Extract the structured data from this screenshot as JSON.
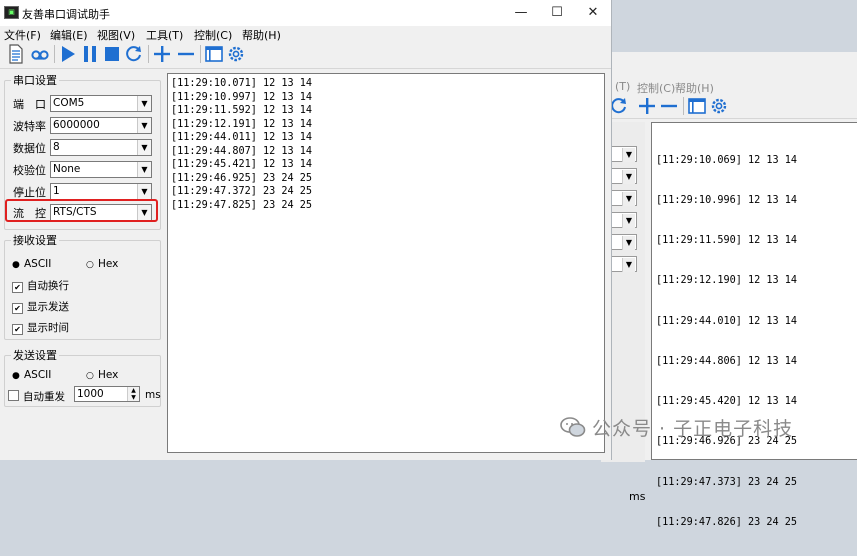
{
  "window": {
    "title": "友善串口调试助手",
    "controls": {
      "minimize": "—",
      "maximize": "☐",
      "close": "✕"
    }
  },
  "menu": [
    "文件(F)",
    "编辑(E)",
    "视图(V)",
    "工具(T)",
    "控制(C)",
    "帮助(H)"
  ],
  "bg_menu": [
    "(T)",
    "控制(C)",
    "帮助(H)"
  ],
  "serial_settings": {
    "legend": "串口设置",
    "fields": [
      {
        "label": "端　口",
        "value": "COM5"
      },
      {
        "label": "波特率",
        "value": "6000000"
      },
      {
        "label": "数据位",
        "value": "8"
      },
      {
        "label": "校验位",
        "value": "None"
      },
      {
        "label": "停止位",
        "value": "1"
      },
      {
        "label": "流　控",
        "value": "RTS/CTS"
      }
    ]
  },
  "receive_settings": {
    "legend": "接收设置",
    "radio_ascii": "ASCII",
    "radio_hex": "Hex",
    "checks": [
      "自动换行",
      "显示发送",
      "显示时间"
    ]
  },
  "send_settings": {
    "legend": "发送设置",
    "radio_ascii": "ASCII",
    "radio_hex": "Hex",
    "auto_resend": "自动重发",
    "interval": "1000",
    "unit": "ms"
  },
  "receive_lines": [
    "[11:29:10.071] 12 13 14",
    "[11:29:10.997] 12 13 14",
    "[11:29:11.592] 12 13 14",
    "[11:29:12.191] 12 13 14",
    "[11:29:44.011] 12 13 14",
    "[11:29:44.807] 12 13 14",
    "[11:29:45.421] 12 13 14",
    "[11:29:46.925] 23 24 25",
    "[11:29:47.372] 23 24 25",
    "[11:29:47.825] 23 24 25"
  ],
  "bg_receive_lines": [
    "[11:29:10.069] 12 13 14",
    "[11:29:10.996] 12 13 14",
    "[11:29:11.590] 12 13 14",
    "[11:29:12.190] 12 13 14",
    "[11:29:44.010] 12 13 14",
    "[11:29:44.806] 12 13 14",
    "[11:29:45.420] 12 13 14",
    "[11:29:46.926] 23 24 25",
    "[11:29:47.373] 23 24 25",
    "[11:29:47.826] 23 24 25"
  ],
  "bg_unit": "ms",
  "watermark": "公众号 · 子正电子科技",
  "colors": {
    "accent_blue": "#1f6fd1",
    "highlight_red": "#e02020"
  }
}
